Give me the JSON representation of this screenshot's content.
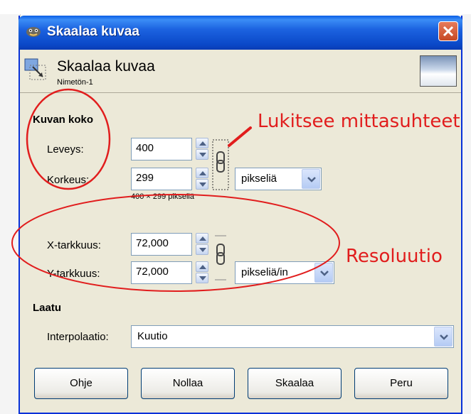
{
  "dialog": {
    "title": "Skaalaa kuvaa",
    "header_title": "Skaalaa kuvaa",
    "header_subtitle": "Nimetön-1",
    "colors": {
      "titlebar": "#0a48c8",
      "annotation": "#e11d1d",
      "window_bg": "#ece9d8"
    }
  },
  "image_size": {
    "section_title": "Kuvan koko",
    "width_label": "Leveys:",
    "width_value": "400",
    "height_label": "Korkeus:",
    "height_value": "299",
    "size_info": "400 × 299 pikseliä",
    "unit": "pikseliä"
  },
  "resolution": {
    "x_label": "X-tarkkuus:",
    "x_value": "72,000",
    "y_label": "Y-tarkkuus:",
    "y_value": "72,000",
    "unit": "pikseliä/in"
  },
  "quality": {
    "section_title": "Laatu",
    "interpolation_label": "Interpolaatio:",
    "interpolation_value": "Kuutio"
  },
  "buttons": {
    "help": "Ohje",
    "reset": "Nollaa",
    "scale": "Skaalaa",
    "cancel": "Peru"
  },
  "annotations": {
    "lock_ratio": "Lukitsee mittasuhteet",
    "resolution": "Resoluutio"
  },
  "icons": [
    "app-icon",
    "close-icon",
    "scale-tool-icon",
    "image-thumbnail",
    "chain-link-icon",
    "chevron-down-icon",
    "spin-arrow-icon"
  ]
}
